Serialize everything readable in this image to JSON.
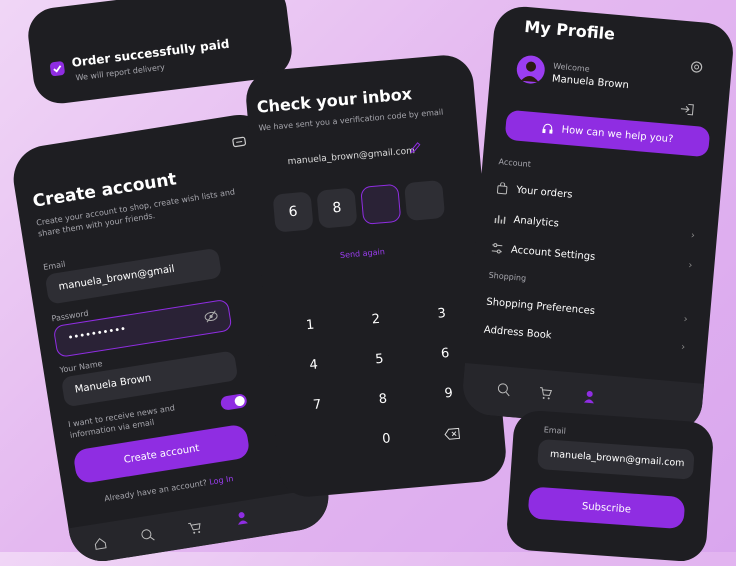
{
  "toast": {
    "title": "Order successfully paid",
    "subtitle": "We will report delivery"
  },
  "signup": {
    "title": "Create account",
    "description": "Create your account to shop, create wish lists and share them with your friends.",
    "email_label": "Email",
    "email_value": "manuela_brown@gmail",
    "password_label": "Password",
    "password_value": "••••••••••",
    "name_label": "Your Name",
    "name_value": "Manuela Brown",
    "news_label": "I want to receive news and information via email",
    "news_enabled": true,
    "create_button": "Create account",
    "have_account": "Already have an account?",
    "login_link": "Log In"
  },
  "verify": {
    "title": "Check your inbox",
    "subtitle": "We have sent you a verification code by email",
    "email": "manuela_brown@gmail.com",
    "digits": [
      "6",
      "8",
      "",
      ""
    ],
    "send_again": "Send again",
    "keypad": [
      "1",
      "2",
      "3",
      "4",
      "5",
      "6",
      "7",
      "8",
      "9",
      "0"
    ]
  },
  "profile": {
    "title": "My Profile",
    "welcome": "Welcome",
    "user_name": "Manuela Brown",
    "help_button": "How can we help you?",
    "account_section": "Account",
    "items": [
      "Your orders",
      "Analytics",
      "Account Settings"
    ],
    "shopping_section": "Shopping",
    "shopping_items": [
      "Shopping Preferences",
      "Address Book"
    ]
  },
  "subscribe": {
    "email_label": "Email",
    "email_value": "manuela_brown@gmail.com",
    "button": "Subscribe"
  },
  "colors": {
    "accent": "#8f2de2",
    "card": "#1e1e22",
    "field": "#2e2e34",
    "background": "#e4b8f0"
  }
}
